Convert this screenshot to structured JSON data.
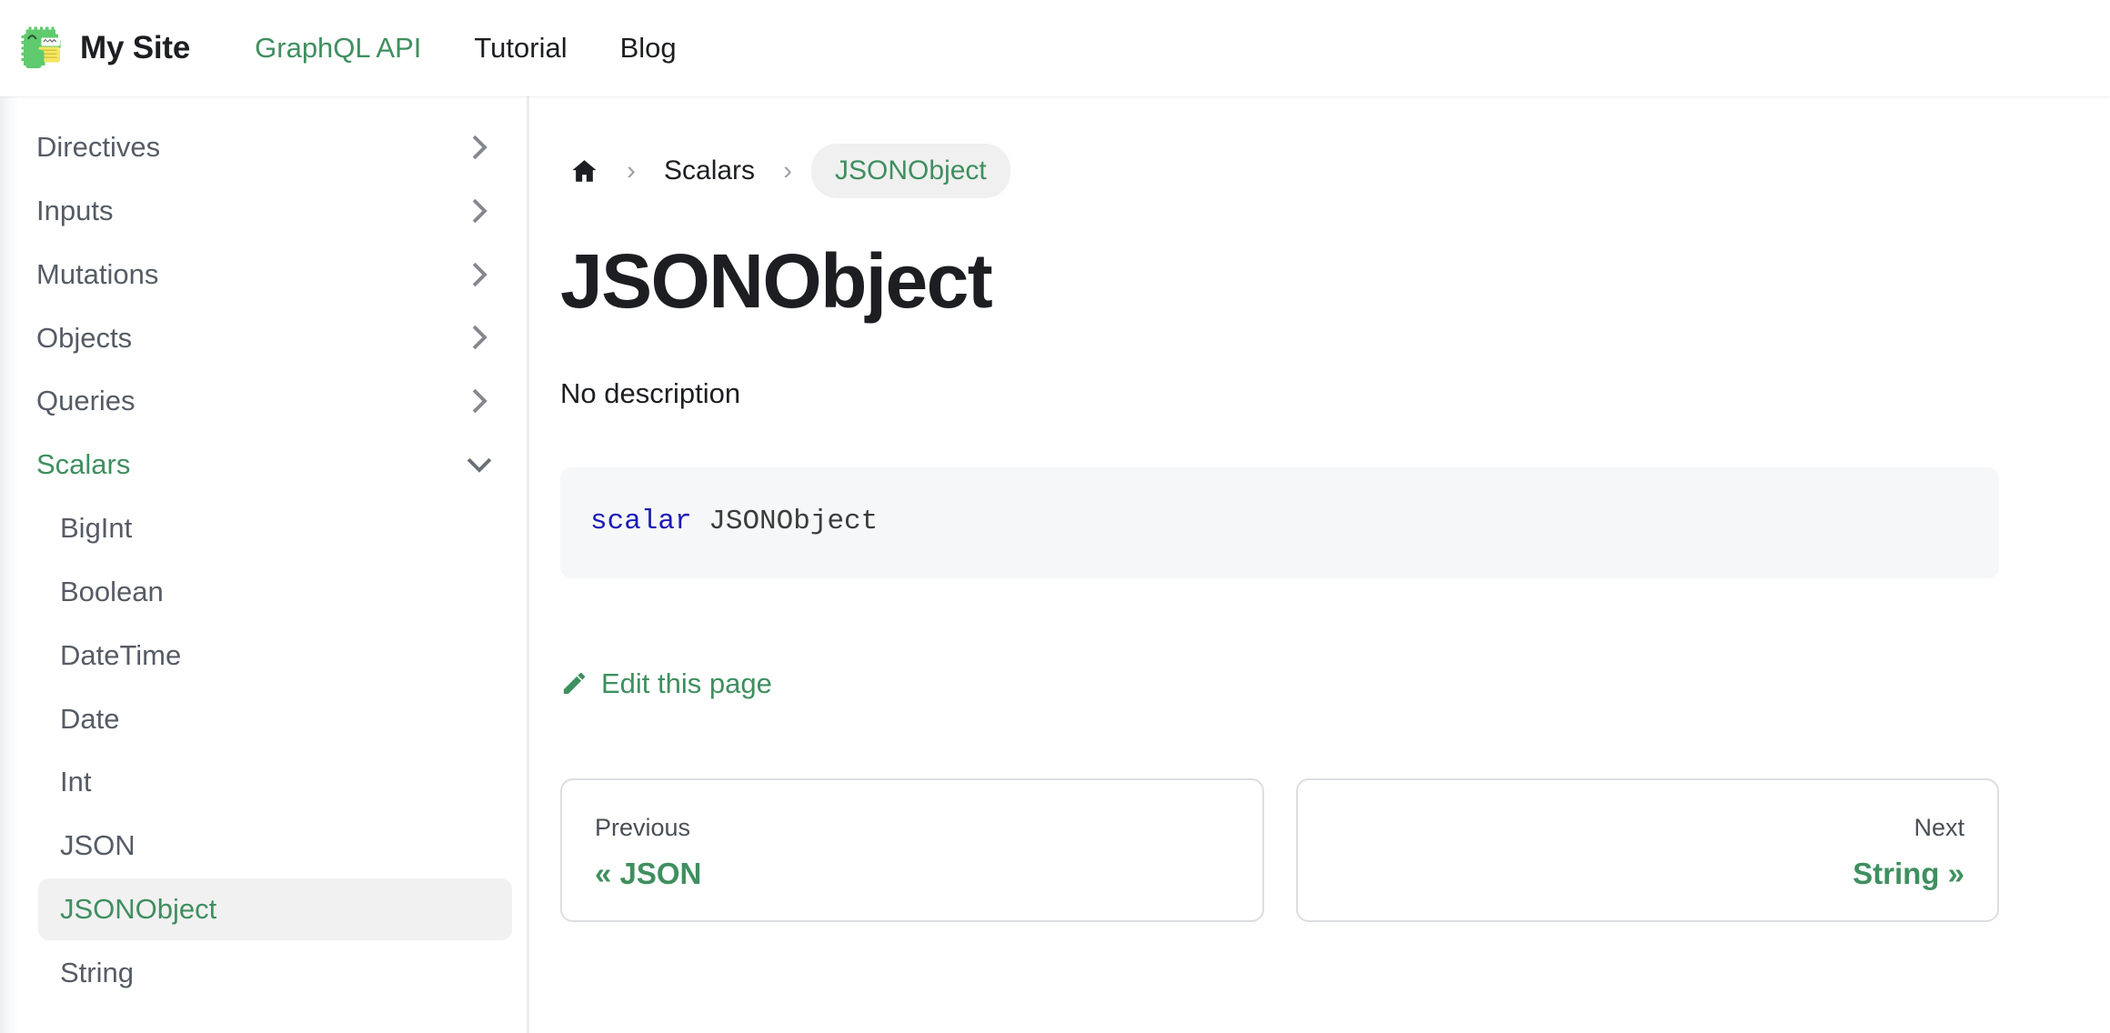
{
  "navbar": {
    "logo_icon": "docusaurus-dino-logo",
    "brand_title": "My Site",
    "links": [
      {
        "label": "GraphQL API",
        "active": true
      },
      {
        "label": "Tutorial",
        "active": false
      },
      {
        "label": "Blog",
        "active": false
      }
    ]
  },
  "sidebar": {
    "categories": [
      {
        "label": "Directives",
        "expanded": false,
        "icon": "chevron-right-icon"
      },
      {
        "label": "Inputs",
        "expanded": false,
        "icon": "chevron-right-icon"
      },
      {
        "label": "Mutations",
        "expanded": false,
        "icon": "chevron-right-icon"
      },
      {
        "label": "Objects",
        "expanded": false,
        "icon": "chevron-right-icon"
      },
      {
        "label": "Queries",
        "expanded": false,
        "icon": "chevron-right-icon"
      },
      {
        "label": "Scalars",
        "expanded": true,
        "icon": "chevron-down-icon"
      }
    ],
    "scalars_items": [
      {
        "label": "BigInt",
        "active": false
      },
      {
        "label": "Boolean",
        "active": false
      },
      {
        "label": "DateTime",
        "active": false
      },
      {
        "label": "Date",
        "active": false
      },
      {
        "label": "Int",
        "active": false
      },
      {
        "label": "JSON",
        "active": false
      },
      {
        "label": "JSONObject",
        "active": true
      },
      {
        "label": "String",
        "active": false
      }
    ]
  },
  "breadcrumbs": {
    "home_icon": "home-icon",
    "separator": "›",
    "parent": "Scalars",
    "current": "JSONObject"
  },
  "doc": {
    "title": "JSONObject",
    "description": "No description",
    "code": {
      "keyword": "scalar",
      "space": " ",
      "name": "JSONObject"
    },
    "edit_link": {
      "icon": "pencil-icon",
      "label": "Edit this page"
    }
  },
  "pagination": {
    "previous": {
      "label": "Previous",
      "title": "« JSON"
    },
    "next": {
      "label": "Next",
      "title": "String »"
    }
  },
  "colors": {
    "brand_green": "#3f8f5f",
    "text_dark": "#1c1e21",
    "sidebar_text": "#565c65",
    "code_bg": "#f6f7f8",
    "keyword_blue": "#1a1ab5",
    "active_bg": "#f1f1f1",
    "border": "#dcdee3"
  }
}
